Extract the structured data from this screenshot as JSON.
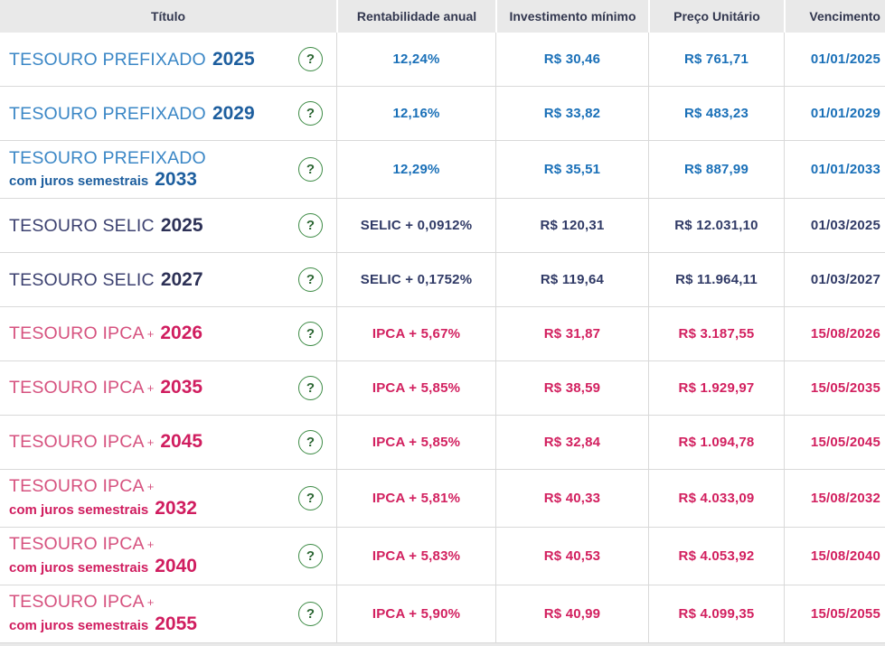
{
  "icons": {
    "help": "?"
  },
  "colors": {
    "header_bg": "#e9e9e9",
    "header_text": "#32374f",
    "border": "#d9d9d9",
    "help_green": "#3d8b45",
    "help_mark": "#2c6633",
    "prefixado_title": "#3b87c6",
    "prefixado_strong": "#1d5e9e",
    "prefixado_value": "#1a70b8",
    "selic_title": "#3c4170",
    "selic_strong": "#2d3156",
    "selic_value": "#303a66",
    "ipca_title": "#d6527f",
    "ipca_strong": "#d01d5f",
    "ipca_value": "#d2205f"
  },
  "table": {
    "columns": [
      {
        "label": "Título"
      },
      {
        "label": "Rentabilidade anual"
      },
      {
        "label": "Investimento mínimo"
      },
      {
        "label": "Preço Unitário"
      },
      {
        "label": "Vencimento"
      }
    ],
    "rows": [
      {
        "family": "prefixado",
        "name": "TESOURO PREFIXADO",
        "plus": "",
        "juros": "",
        "year": "2025",
        "rate": "12,24%",
        "min_investment": "R$ 30,46",
        "unit_price": "R$ 761,71",
        "maturity": "01/01/2025"
      },
      {
        "family": "prefixado",
        "name": "TESOURO PREFIXADO",
        "plus": "",
        "juros": "",
        "year": "2029",
        "rate": "12,16%",
        "min_investment": "R$ 33,82",
        "unit_price": "R$ 483,23",
        "maturity": "01/01/2029"
      },
      {
        "family": "prefixado",
        "name": "TESOURO PREFIXADO",
        "plus": "",
        "juros": "com juros semestrais",
        "year": "2033",
        "rate": "12,29%",
        "min_investment": "R$ 35,51",
        "unit_price": "R$ 887,99",
        "maturity": "01/01/2033"
      },
      {
        "family": "selic",
        "name": "TESOURO SELIC",
        "plus": "",
        "juros": "",
        "year": "2025",
        "rate": "SELIC + 0,0912%",
        "min_investment": "R$ 120,31",
        "unit_price": "R$ 12.031,10",
        "maturity": "01/03/2025"
      },
      {
        "family": "selic",
        "name": "TESOURO SELIC",
        "plus": "",
        "juros": "",
        "year": "2027",
        "rate": "SELIC + 0,1752%",
        "min_investment": "R$ 119,64",
        "unit_price": "R$ 11.964,11",
        "maturity": "01/03/2027"
      },
      {
        "family": "ipca",
        "name": "TESOURO IPCA",
        "plus": "+",
        "juros": "",
        "year": "2026",
        "rate": "IPCA + 5,67%",
        "min_investment": "R$ 31,87",
        "unit_price": "R$ 3.187,55",
        "maturity": "15/08/2026"
      },
      {
        "family": "ipca",
        "name": "TESOURO IPCA",
        "plus": "+",
        "juros": "",
        "year": "2035",
        "rate": "IPCA + 5,85%",
        "min_investment": "R$ 38,59",
        "unit_price": "R$ 1.929,97",
        "maturity": "15/05/2035"
      },
      {
        "family": "ipca",
        "name": "TESOURO IPCA",
        "plus": "+",
        "juros": "",
        "year": "2045",
        "rate": "IPCA + 5,85%",
        "min_investment": "R$ 32,84",
        "unit_price": "R$ 1.094,78",
        "maturity": "15/05/2045"
      },
      {
        "family": "ipca",
        "name": "TESOURO IPCA",
        "plus": "+",
        "juros": "com juros semestrais",
        "year": "2032",
        "rate": "IPCA + 5,81%",
        "min_investment": "R$ 40,33",
        "unit_price": "R$ 4.033,09",
        "maturity": "15/08/2032"
      },
      {
        "family": "ipca",
        "name": "TESOURO IPCA",
        "plus": "+",
        "juros": "com juros semestrais",
        "year": "2040",
        "rate": "IPCA + 5,83%",
        "min_investment": "R$ 40,53",
        "unit_price": "R$ 4.053,92",
        "maturity": "15/08/2040"
      },
      {
        "family": "ipca",
        "name": "TESOURO IPCA",
        "plus": "+",
        "juros": "com juros semestrais",
        "year": "2055",
        "rate": "IPCA + 5,90%",
        "min_investment": "R$ 40,99",
        "unit_price": "R$ 4.099,35",
        "maturity": "15/05/2055"
      }
    ]
  }
}
